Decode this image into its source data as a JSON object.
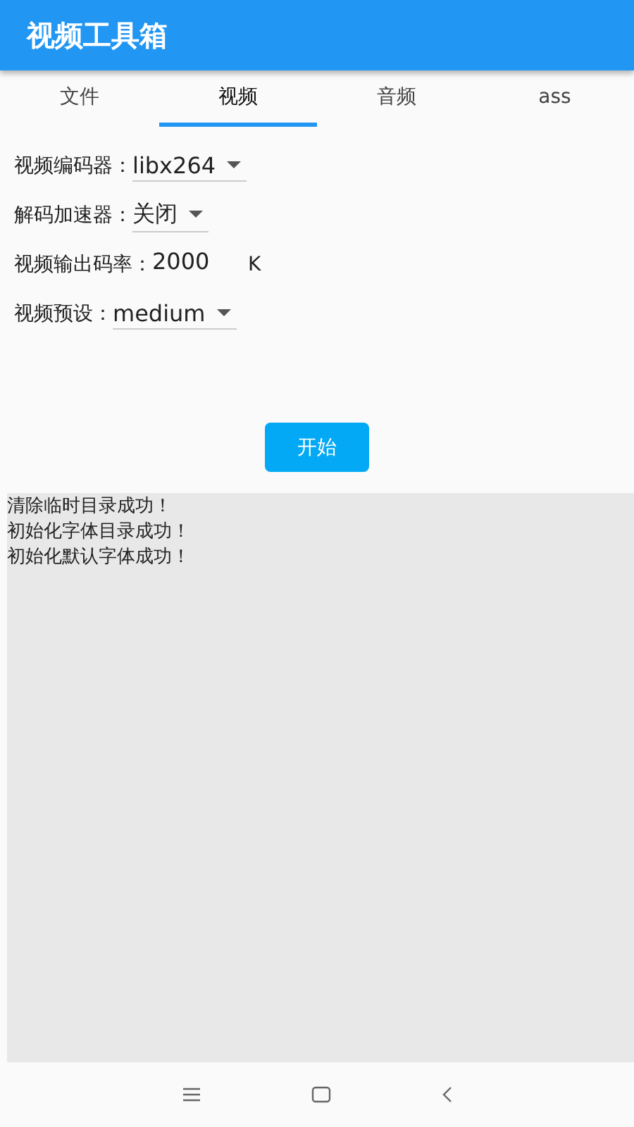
{
  "app_bar": {
    "title": "视频工具箱"
  },
  "tabs": [
    {
      "label": "文件",
      "selected": false
    },
    {
      "label": "视频",
      "selected": true
    },
    {
      "label": "音频",
      "selected": false
    },
    {
      "label": "ass",
      "selected": false
    }
  ],
  "fields": [
    {
      "kind": "dropdown",
      "label": "视频编码器：",
      "value": "libx264"
    },
    {
      "kind": "dropdown",
      "label": "解码加速器：",
      "value": "关闭"
    },
    {
      "kind": "input",
      "label": "视频输出码率：",
      "value": "2000",
      "unit": "K"
    },
    {
      "kind": "dropdown",
      "label": "视频预设：",
      "value": "medium"
    }
  ],
  "start_button": "开始",
  "log_lines": [
    "清除临时目录成功！",
    "初始化字体目录成功！",
    "初始化默认字体成功！"
  ]
}
